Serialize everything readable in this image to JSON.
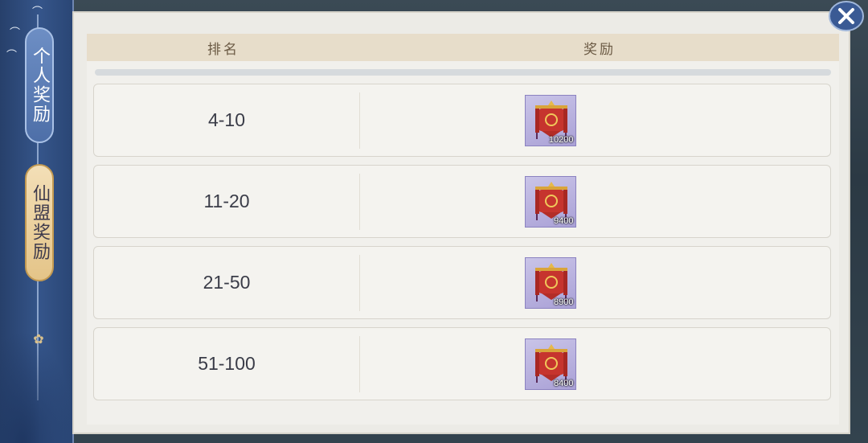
{
  "tabs": [
    {
      "label": "个人奖励",
      "active": true
    },
    {
      "label": "仙盟奖励",
      "active": false
    }
  ],
  "table": {
    "headers": {
      "rank": "排名",
      "reward": "奖励"
    },
    "rows": [
      {
        "rank": "4-10",
        "reward_icon": "red-banner-icon",
        "reward_count": "10200"
      },
      {
        "rank": "11-20",
        "reward_icon": "red-banner-icon",
        "reward_count": "9400"
      },
      {
        "rank": "21-50",
        "reward_icon": "red-banner-icon",
        "reward_count": "8900"
      },
      {
        "rank": "51-100",
        "reward_icon": "red-banner-icon",
        "reward_count": "8400"
      }
    ]
  },
  "icons": {
    "close": "close-icon"
  },
  "colors": {
    "active_tab": "#5676ad",
    "inactive_tab": "#e9ce98",
    "header_bg": "#e7ddca",
    "row_bg": "#f4f3ef",
    "item_bg": "#b8b0df",
    "banner_red": "#c6342e"
  }
}
